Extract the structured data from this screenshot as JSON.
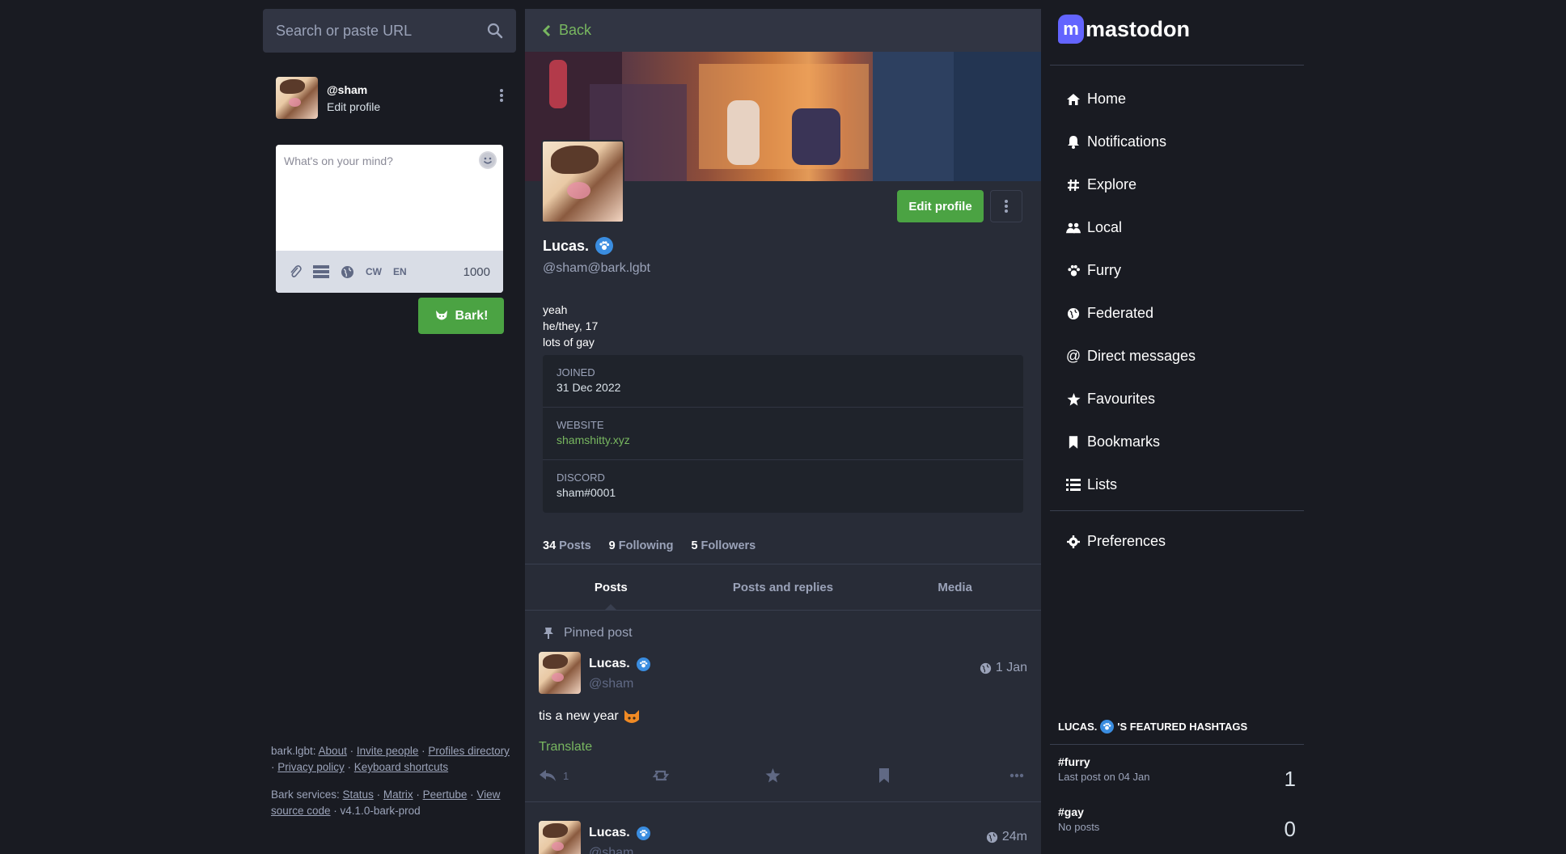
{
  "search": {
    "placeholder": "Search or paste URL"
  },
  "me": {
    "acct": "@sham",
    "edit_label": "Edit profile"
  },
  "composer": {
    "placeholder": "What's on your mind?",
    "cw_label": "CW",
    "lang_label": "EN",
    "char_count": "1000",
    "submit_label": "Bark!"
  },
  "footer": {
    "instance": "bark.lgbt",
    "links": [
      "About",
      "Invite people",
      "Profiles directory",
      "Privacy policy",
      "Keyboard shortcuts"
    ],
    "services_label": "Bark services",
    "services": [
      "Status",
      "Matrix",
      "Peertube",
      "View source code"
    ],
    "version": "v4.1.0-bark-prod"
  },
  "profile": {
    "back_label": "Back",
    "display_name": "Lucas.",
    "handle": "@sham@bark.lgbt",
    "edit_button": "Edit profile",
    "bio": [
      "yeah",
      "he/they, 17",
      "lots of gay"
    ],
    "fields": [
      {
        "label": "JOINED",
        "value": "31 Dec 2022"
      },
      {
        "label": "WEBSITE",
        "value": "shamshitty.xyz"
      },
      {
        "label": "DISCORD",
        "value": "sham#0001"
      }
    ],
    "stats": {
      "posts_count": "34",
      "posts_label": "Posts",
      "following_count": "9",
      "following_label": "Following",
      "followers_count": "5",
      "followers_label": "Followers"
    },
    "tabs": [
      "Posts",
      "Posts and replies",
      "Media"
    ],
    "pinned_label": "Pinned post"
  },
  "posts": [
    {
      "name": "Lucas.",
      "handle": "@sham",
      "time": "1 Jan",
      "text": "tis a new year",
      "translate": "Translate",
      "reply_count": "1"
    },
    {
      "name": "Lucas.",
      "handle": "@sham",
      "time": "24m"
    }
  ],
  "nav": {
    "logo": "mastodon",
    "items": [
      "Home",
      "Notifications",
      "Explore",
      "Local",
      "Furry",
      "Federated",
      "Direct messages",
      "Favourites",
      "Bookmarks",
      "Lists"
    ],
    "preferences": "Preferences"
  },
  "featured": {
    "title_prefix": "LUCAS.",
    "title_suffix": "'S FEATURED HASHTAGS",
    "tags": [
      {
        "tag": "#furry",
        "sub": "Last post on 04 Jan",
        "count": "1"
      },
      {
        "tag": "#gay",
        "sub": "No posts",
        "count": "0"
      }
    ]
  },
  "colors": {
    "accent_green": "#4ba343",
    "link_green": "#78b760",
    "brand": "#6364ff",
    "bg": "#191b22",
    "panel": "#282c37"
  }
}
